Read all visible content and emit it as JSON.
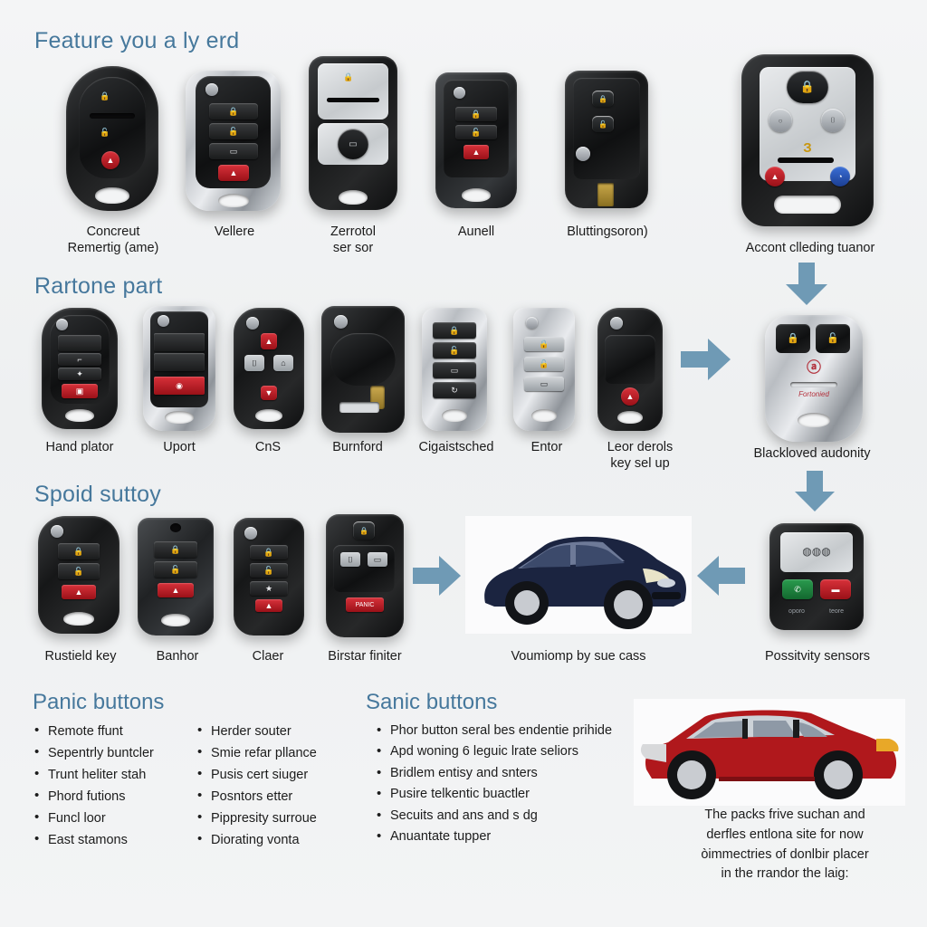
{
  "sections": [
    {
      "title": "Feature you a ly erd"
    },
    {
      "title": "Rartone part"
    },
    {
      "title": "Spoid suttoy"
    }
  ],
  "row1": {
    "captions": [
      "Concreut\nRemertig (ame)",
      "Vellere",
      "Zerrotol\nser sor",
      "Aunell",
      "Bluttingsoron)"
    ],
    "featured_caption": "Accont clleding tuanor"
  },
  "row2": {
    "captions": [
      "Hand plator",
      "Uport",
      "CnS",
      "Burnford",
      "Cigaistsched",
      "Entor",
      "Leor derols\nkey sel up"
    ],
    "featured_caption": "Blackloved audonity"
  },
  "row3": {
    "captions": [
      "Rustield key",
      "Banhor",
      "Claer",
      "Birstar finiter"
    ],
    "car_caption": "Voumiomp by sue cass",
    "featured_caption": "Possitvity sensors"
  },
  "bottom": {
    "left_title": "Panic buttons",
    "right_title": "Sanic buttons",
    "left_col1": [
      "Remote ffunt",
      "Sepentrly buntcler",
      "Trunt heliter stah",
      "Phord futions",
      "Funcl loor",
      "East stamons"
    ],
    "left_col2": [
      "Herder souter",
      "Smie refar pllance",
      "Pusis cert siuger",
      "Posntors etter",
      "Pippresity surroue",
      "Diorating vonta"
    ],
    "right_col": [
      "Phor button seral bes endentie prihide",
      "Apd woning 6 leguic lrate seliors",
      "Bridlem entisy and snters",
      "Pusire telkentic buactler",
      "Secuits and ans and s dg",
      "Anuantate tupper"
    ],
    "footnote": "The packs frive suchan and\nderfles entlona site for now\nòimmectries of donlbir placer\nin the rrandor the laig:"
  },
  "colors": {
    "accent_heading": "#46789c",
    "arrow": "#6f9ab5",
    "background": "#f2f3f4",
    "navy_car": "#1b2440",
    "red_car": "#b0181c"
  },
  "icons": {
    "lock": "lock-icon",
    "unlock": "unlock-icon",
    "panic": "panic-icon",
    "trunk": "trunk-icon",
    "remote_start": "remote-start-icon",
    "arrow_down": "arrow-down-icon",
    "arrow_right": "arrow-right-icon",
    "arrow_left": "arrow-left-icon"
  }
}
